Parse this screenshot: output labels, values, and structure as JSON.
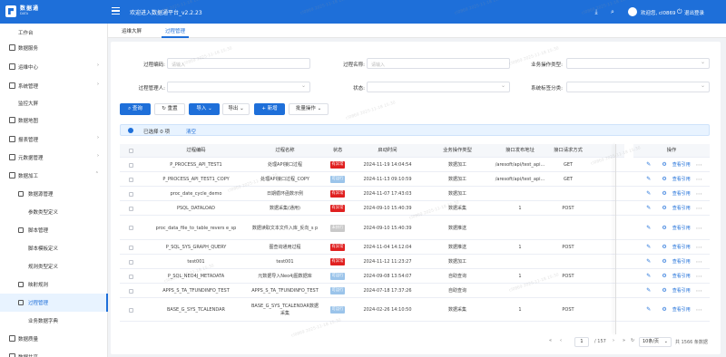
{
  "app": {
    "brand": "数据通",
    "brand_sub": "DATA",
    "welcome": "欢迎进入数据通平台_v2.2.23",
    "user": "欢迎您, cl0869",
    "logout": "退出登录",
    "watermark": "cl0869 2025-11-18 15:30"
  },
  "colors": {
    "primary": "#1e6fd9",
    "danger": "#e02020",
    "success_tag": "#9bc4ea",
    "unknown_tag": "#c9c9c9"
  },
  "sidebar": {
    "items": [
      {
        "label": "工作台",
        "icon": "",
        "arrow": ""
      },
      {
        "label": "数据服务",
        "icon": "server-icon",
        "arrow": ""
      },
      {
        "label": "运维中心",
        "icon": "monitor-icon",
        "arrow": "›"
      },
      {
        "label": "系统管理",
        "icon": "gear-icon",
        "arrow": "›"
      },
      {
        "label": "监控大屏",
        "icon": "",
        "arrow": ""
      },
      {
        "label": "数据地图",
        "icon": "map-icon",
        "arrow": ""
      },
      {
        "label": "报表管理",
        "icon": "report-icon",
        "arrow": "›"
      },
      {
        "label": "元数据管理",
        "icon": "metadata-icon",
        "arrow": "›"
      },
      {
        "label": "数据加工",
        "icon": "process-icon",
        "arrow": "⌃"
      },
      {
        "label": "数据源管理",
        "icon": "datasource-icon",
        "arrow": ""
      },
      {
        "label": "参数类型定义",
        "icon": "",
        "arrow": ""
      },
      {
        "label": "脚本管理",
        "icon": "script-icon",
        "arrow": ""
      },
      {
        "label": "脚本模板定义",
        "icon": "",
        "arrow": ""
      },
      {
        "label": "规则类型定义",
        "icon": "",
        "arrow": ""
      },
      {
        "label": "映射规则",
        "icon": "mapping-icon",
        "arrow": ""
      },
      {
        "label": "过程管理",
        "icon": "process-mgmt-icon",
        "arrow": ""
      },
      {
        "label": "业务数据字典",
        "icon": "",
        "arrow": ""
      },
      {
        "label": "数据质量",
        "icon": "quality-icon",
        "arrow": ""
      },
      {
        "label": "数据共享",
        "icon": "share-icon",
        "arrow": ""
      }
    ]
  },
  "tabs": [
    {
      "label": "运维大屏"
    },
    {
      "label": "过程管理"
    }
  ],
  "filters": {
    "code_label": "过程编码:",
    "code_placeholder": "请输入",
    "name_label": "过程名称:",
    "name_placeholder": "请输入",
    "biz_type_label": "业务操作类型:",
    "manager_label": "过程管理人:",
    "status_label": "状态:",
    "tag_label": "系统标签分类:"
  },
  "toolbar": {
    "query": "查询",
    "reset": "重置",
    "import": "导入",
    "export": "导出",
    "add": "新增",
    "batch": "批量操作"
  },
  "selection": {
    "text": "已选择 0 项",
    "clear": "清空"
  },
  "table": {
    "headers": [
      "",
      "过程编码",
      "过程名称",
      "状态",
      "启动时间",
      "业务操作类型",
      "接口发布地址",
      "接口请求方式",
      "",
      "操作"
    ],
    "view_label": "查看引用",
    "rows": [
      {
        "code": "P_PROCESS_API_TEST1",
        "name": "处理API接口过程",
        "status": "有异常",
        "status_kind": "err",
        "time": "2024-11-19 14:04:54",
        "type": "数据加工",
        "url": "/aresoft/api/test_api...",
        "method": "GET"
      },
      {
        "code": "P_PROCESS_API_TEST1_COPY",
        "name": "处理API接口过程_COPY",
        "status": "可运行",
        "status_kind": "ok",
        "time": "2024-11-13 09:10:59",
        "type": "数据加工",
        "url": "/aresoft/api/test_api...",
        "method": "GET"
      },
      {
        "code": "proc_date_cycle_demo",
        "name": "日期循环函数示例",
        "status": "有异常",
        "status_kind": "err",
        "time": "2024-11-07 17:43:03",
        "type": "数据加工",
        "url": "",
        "method": ""
      },
      {
        "code": "PSQL_DATALOAD",
        "name": "数据采集(通用)",
        "status": "有异常",
        "status_kind": "err",
        "time": "2024-09-10 15:40:39",
        "type": "数据采集",
        "url": "1",
        "method": "POST"
      },
      {
        "code": "proc_data_file_to_table_revers e_sp",
        "name": "数据读取文本文件入库_反向_s p",
        "status": "未执行",
        "status_kind": "unk",
        "time": "2024-09-10 15:40:39",
        "type": "数据推送",
        "url": "",
        "method": ""
      },
      {
        "code": "P_SQL_SYS_GRAPH_QUERY",
        "name": "图查询通用过程",
        "status": "有异常",
        "status_kind": "err",
        "time": "2024-11-04 14:12:04",
        "type": "数据推送",
        "url": "1",
        "method": "POST"
      },
      {
        "code": "test001",
        "name": "test001",
        "status": "有异常",
        "status_kind": "err",
        "time": "2024-11-12 11:23:27",
        "type": "数据加工",
        "url": "",
        "method": ""
      },
      {
        "code": "P_SQL_NEO4J_METADATA",
        "name": "元数据导入Neo4j图数据库",
        "status": "可运行",
        "status_kind": "ok",
        "time": "2024-09-08 13:54:07",
        "type": "自助查询",
        "url": "1",
        "method": "POST"
      },
      {
        "code": "APPS_S_TA_TFUNDINFO_TEST",
        "name": "APPS_S_TA_TFUNDINFO_TEST",
        "status": "可运行",
        "status_kind": "ok",
        "time": "2024-07-18 17:37:26",
        "type": "自助查询",
        "url": "",
        "method": ""
      },
      {
        "code": "BASE_G_SYS_TCALENDAR",
        "name": "BASE_G_SYS_TCALENDAR数据 采集",
        "status": "可运行",
        "status_kind": "ok",
        "time": "2024-02-26 14:10:50",
        "type": "数据采集",
        "url": "1",
        "method": "POST"
      }
    ]
  },
  "pagination": {
    "current": "1",
    "total_pages": "/ 157",
    "page_size": "10条/页",
    "total": "共 1566 条数据"
  }
}
